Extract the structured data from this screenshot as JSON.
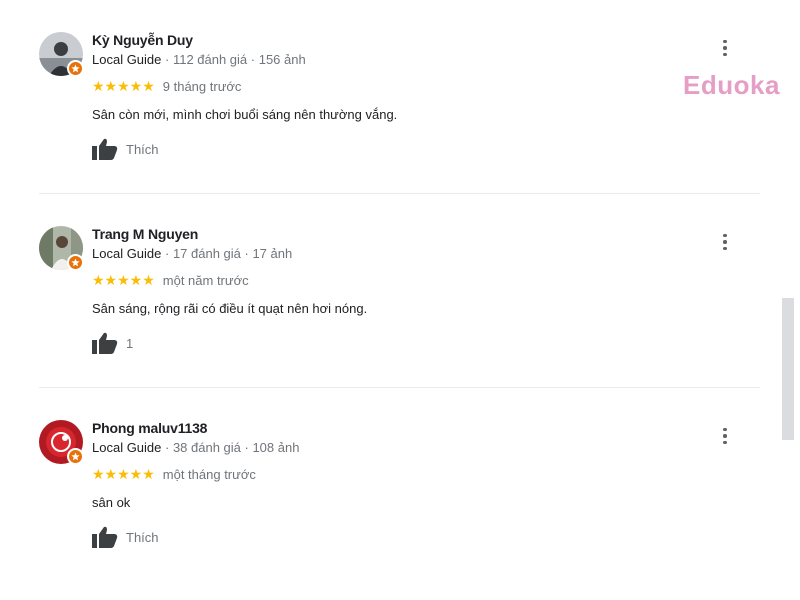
{
  "watermark": {
    "text": "Eduoka",
    "color": "#e59fc6"
  },
  "colors": {
    "star": "#fbbc04",
    "badge": "#e8710a",
    "meta": "#70757a"
  },
  "reviews": [
    {
      "author": "Kỳ Nguyễn Duy",
      "guide": "Local Guide",
      "stats": " · 112 đánh giá · 156 ảnh",
      "stars": "★★★★★",
      "rating": 5,
      "time": "9 tháng trước",
      "text": "Sân còn mới, mình chơi buổi sáng nên thường vắng.",
      "like_label": "Thích"
    },
    {
      "author": "Trang M Nguyen",
      "guide": "Local Guide",
      "stats": " · 17 đánh giá · 17 ảnh",
      "stars": "★★★★★",
      "rating": 5,
      "time": "một năm trước",
      "text": "Sân sáng, rộng rãi có điều ít quạt nên hơi nóng.",
      "like_label": "1"
    },
    {
      "author": "Phong maluv1138",
      "guide": "Local Guide",
      "stats": " · 38 đánh giá · 108 ảnh",
      "stars": "★★★★★",
      "rating": 5,
      "time": "một tháng trước",
      "text": "sân ok",
      "like_label": "Thích"
    }
  ],
  "icons": {
    "more": "more-vert-icon",
    "like": "thumb-up-icon",
    "badge": "local-guide-badge-icon"
  }
}
